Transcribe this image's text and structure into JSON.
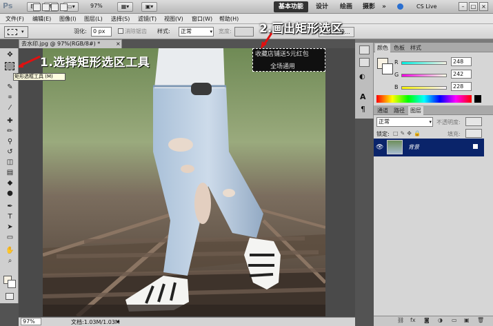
{
  "app": {
    "logo": "Ps",
    "buttons": [
      "Br",
      "Mb"
    ],
    "zoom": "97%",
    "workspaces": [
      "基本功能",
      "设计",
      "绘画",
      "摄影"
    ],
    "more": "»",
    "cs_live": "CS Live",
    "window_controls": [
      "–",
      "□",
      "×"
    ]
  },
  "menu": [
    "文件(F)",
    "编辑(E)",
    "图像(I)",
    "图层(L)",
    "选择(S)",
    "滤镜(T)",
    "视图(V)",
    "窗口(W)",
    "帮助(H)"
  ],
  "options": {
    "feather_label": "羽化:",
    "feather_value": "0 px",
    "antialias_label": "消除锯齿",
    "style_label": "样式:",
    "style_value": "正常",
    "width_label": "宽度:",
    "refine_label": "调整边缘..."
  },
  "document": {
    "tab_title": "去水印.jpg @ 97%(RGB/8#) *",
    "status_zoom": "97%",
    "status_doc": "文档:1.03M/1.03M"
  },
  "tooltip": "矩形选框工具 (M)",
  "annotations": {
    "step1": "1.选择矩形选区工具",
    "step2": "2.画出矩形选区"
  },
  "watermark": {
    "line1": "收藏店铺送5元红包",
    "line2": "全场通用"
  },
  "color_panel": {
    "tabs": [
      "颜色",
      "色板",
      "样式"
    ],
    "channels": [
      {
        "label": "R",
        "value": "248"
      },
      {
        "label": "G",
        "value": "242"
      },
      {
        "label": "B",
        "value": "228"
      }
    ],
    "fg_color": "#f8f2e4"
  },
  "layers_panel": {
    "tabs": [
      "通道",
      "路径",
      "图层"
    ],
    "blend_mode": "正常",
    "opacity_label": "不透明度:",
    "lock_label": "锁定:",
    "fill_label": "填充:",
    "layer_name": "背景"
  },
  "colors": {
    "accent_blue": "#0a246a",
    "annotation_text": "#ffffff",
    "annotation_arrow": "#e01010"
  }
}
